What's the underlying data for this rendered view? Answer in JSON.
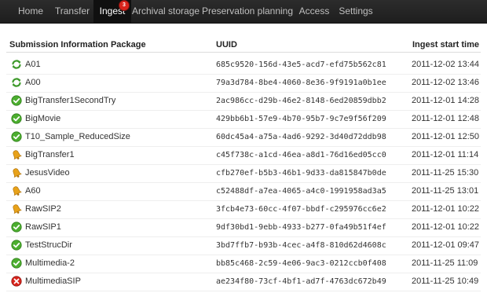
{
  "nav": {
    "items": [
      {
        "label": "Home"
      },
      {
        "label": "Transfer"
      },
      {
        "label": "Ingest",
        "badge": "3",
        "active": true
      },
      {
        "label": "Archival storage"
      },
      {
        "label": "Preservation planning"
      },
      {
        "label": "Access"
      },
      {
        "label": "Settings"
      }
    ]
  },
  "table": {
    "headers": {
      "name": "Submission Information Package",
      "uuid": "UUID",
      "date": "Ingest start time"
    },
    "rows": [
      {
        "status": "processing",
        "icon": "processing-icon",
        "name": "A01",
        "uuid": "685c9520-156d-43e5-acd7-efd75b562c81",
        "date": "2011-12-02 13:44"
      },
      {
        "status": "processing",
        "icon": "processing-icon",
        "name": "A00",
        "uuid": "79a3d784-8be4-4060-8e36-9f9191a0b1ee",
        "date": "2011-12-02 13:46"
      },
      {
        "status": "complete",
        "icon": "check-icon",
        "name": "BigTransfer1SecondTry",
        "uuid": "2ac986cc-d29b-46e2-8148-6ed20859dbb2",
        "date": "2011-12-01 14:28"
      },
      {
        "status": "complete",
        "icon": "check-icon",
        "name": "BigMovie",
        "uuid": "429bb6b1-57e9-4b70-95b7-9c7e9f56f209",
        "date": "2011-12-01 12:48"
      },
      {
        "status": "complete",
        "icon": "check-icon",
        "name": "T10_Sample_ReducedSize",
        "uuid": "60dc45a4-a75a-4ad6-9292-3d40d72ddb98",
        "date": "2011-12-01 12:50"
      },
      {
        "status": "awaiting",
        "icon": "bell-icon",
        "name": "BigTransfer1",
        "uuid": "c45f738c-a1cd-46ea-a8d1-76d16ed05cc0",
        "date": "2011-12-01 11:14"
      },
      {
        "status": "awaiting",
        "icon": "bell-icon",
        "name": "JesusVideo",
        "uuid": "cfb270ef-b5b3-46b1-9d33-da815847b0de",
        "date": "2011-11-25 15:30"
      },
      {
        "status": "awaiting",
        "icon": "bell-icon",
        "name": "A60",
        "uuid": "c52488df-a7ea-4065-a4c0-1991958ad3a5",
        "date": "2011-11-25 13:01"
      },
      {
        "status": "awaiting",
        "icon": "bell-icon",
        "name": "RawSIP2",
        "uuid": "3fcb4e73-60cc-4f07-bbdf-c295976cc6e2",
        "date": "2011-12-01 10:22"
      },
      {
        "status": "complete",
        "icon": "check-icon",
        "name": "RawSIP1",
        "uuid": "9df30bd1-9ebb-4933-b277-0fa49b51f4ef",
        "date": "2011-12-01 10:22"
      },
      {
        "status": "complete",
        "icon": "check-icon",
        "name": "TestStrucDir",
        "uuid": "3bd7ffb7-b93b-4cec-a4f8-810d62d4608c",
        "date": "2011-12-01 09:47"
      },
      {
        "status": "complete",
        "icon": "check-icon",
        "name": "Multimedia-2",
        "uuid": "bb85c468-2c59-4e06-9ac3-0212ccb0f408",
        "date": "2011-11-25 11:09"
      },
      {
        "status": "failed",
        "icon": "error-icon",
        "name": "MultimediaSIP",
        "uuid": "ae234f80-73cf-4bf1-ad7f-4763dc672b49",
        "date": "2011-11-25 10:49"
      }
    ]
  },
  "colors": {
    "navbar": "#222222",
    "complete": "#4cae2f",
    "processing": "#3e9a2b",
    "awaiting": "#e8a21a",
    "failed": "#d9241c"
  }
}
